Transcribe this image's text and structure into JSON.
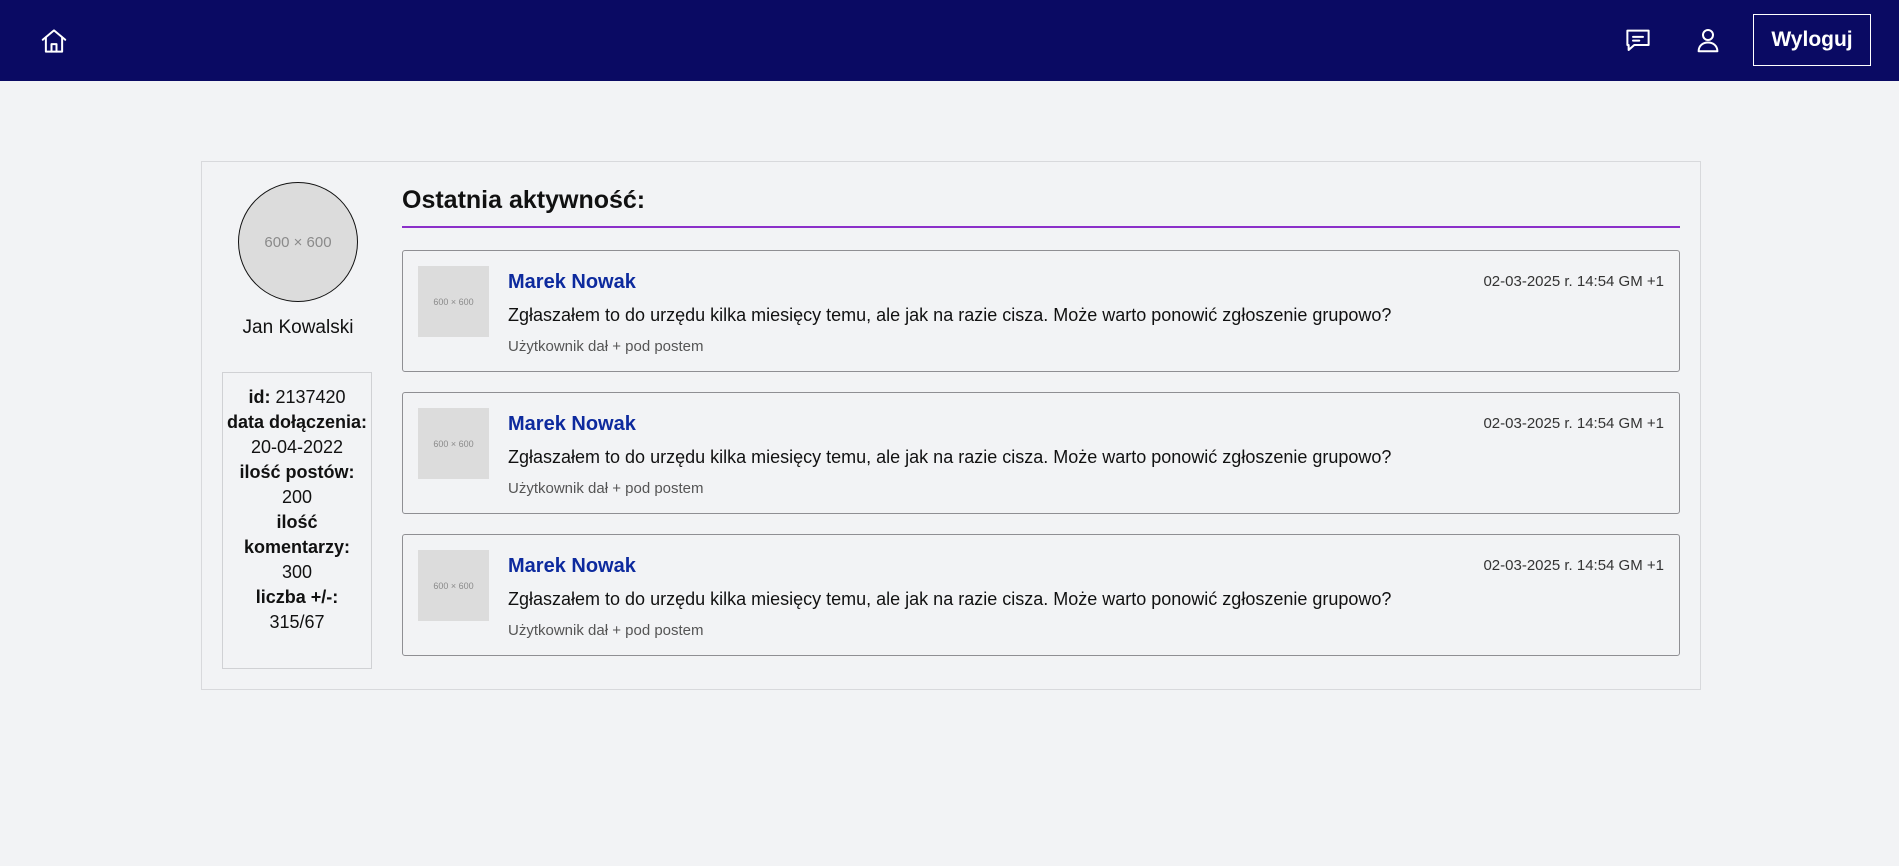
{
  "navbar": {
    "background": "#0a0a63",
    "home_icon": "home-icon",
    "messages_icon": "chat-bubble-icon",
    "profile_icon": "user-icon",
    "logout_label": "Wyloguj"
  },
  "profile": {
    "avatar_placeholder": "600 × 600",
    "name": "Jan Kowalski",
    "stats": {
      "id_label": "id:",
      "id_value": "2137420",
      "joined_label": "data dołączenia:",
      "joined_value": "20-04-2022",
      "posts_label": "ilość postów:",
      "posts_value": "200",
      "comments_label": "ilość komentarzy:",
      "comments_value": "300",
      "score_label": "liczba +/-:",
      "score_value": "315/67"
    }
  },
  "activity": {
    "title": "Ostatnia aktywność:",
    "accent_color": "#8b2fc9",
    "posts": [
      {
        "thumb_placeholder": "600 × 600",
        "author": "Marek Nowak",
        "date": "02-03-2025 r. 14:54 GM +1",
        "text": "Zgłaszałem to do urzędu kilka miesięcy temu, ale jak na razie cisza. Może warto ponowić zgłoszenie grupowo?",
        "note": "Użytkownik dał + pod postem"
      },
      {
        "thumb_placeholder": "600 × 600",
        "author": "Marek Nowak",
        "date": "02-03-2025 r. 14:54 GM +1",
        "text": "Zgłaszałem to do urzędu kilka miesięcy temu, ale jak na razie cisza. Może warto ponowić zgłoszenie grupowo?",
        "note": "Użytkownik dał + pod postem"
      },
      {
        "thumb_placeholder": "600 × 600",
        "author": "Marek Nowak",
        "date": "02-03-2025 r. 14:54 GM +1",
        "text": "Zgłaszałem to do urzędu kilka miesięcy temu, ale jak na razie cisza. Może warto ponowić zgłoszenie grupowo?",
        "note": "Użytkownik dał + pod postem"
      }
    ]
  }
}
